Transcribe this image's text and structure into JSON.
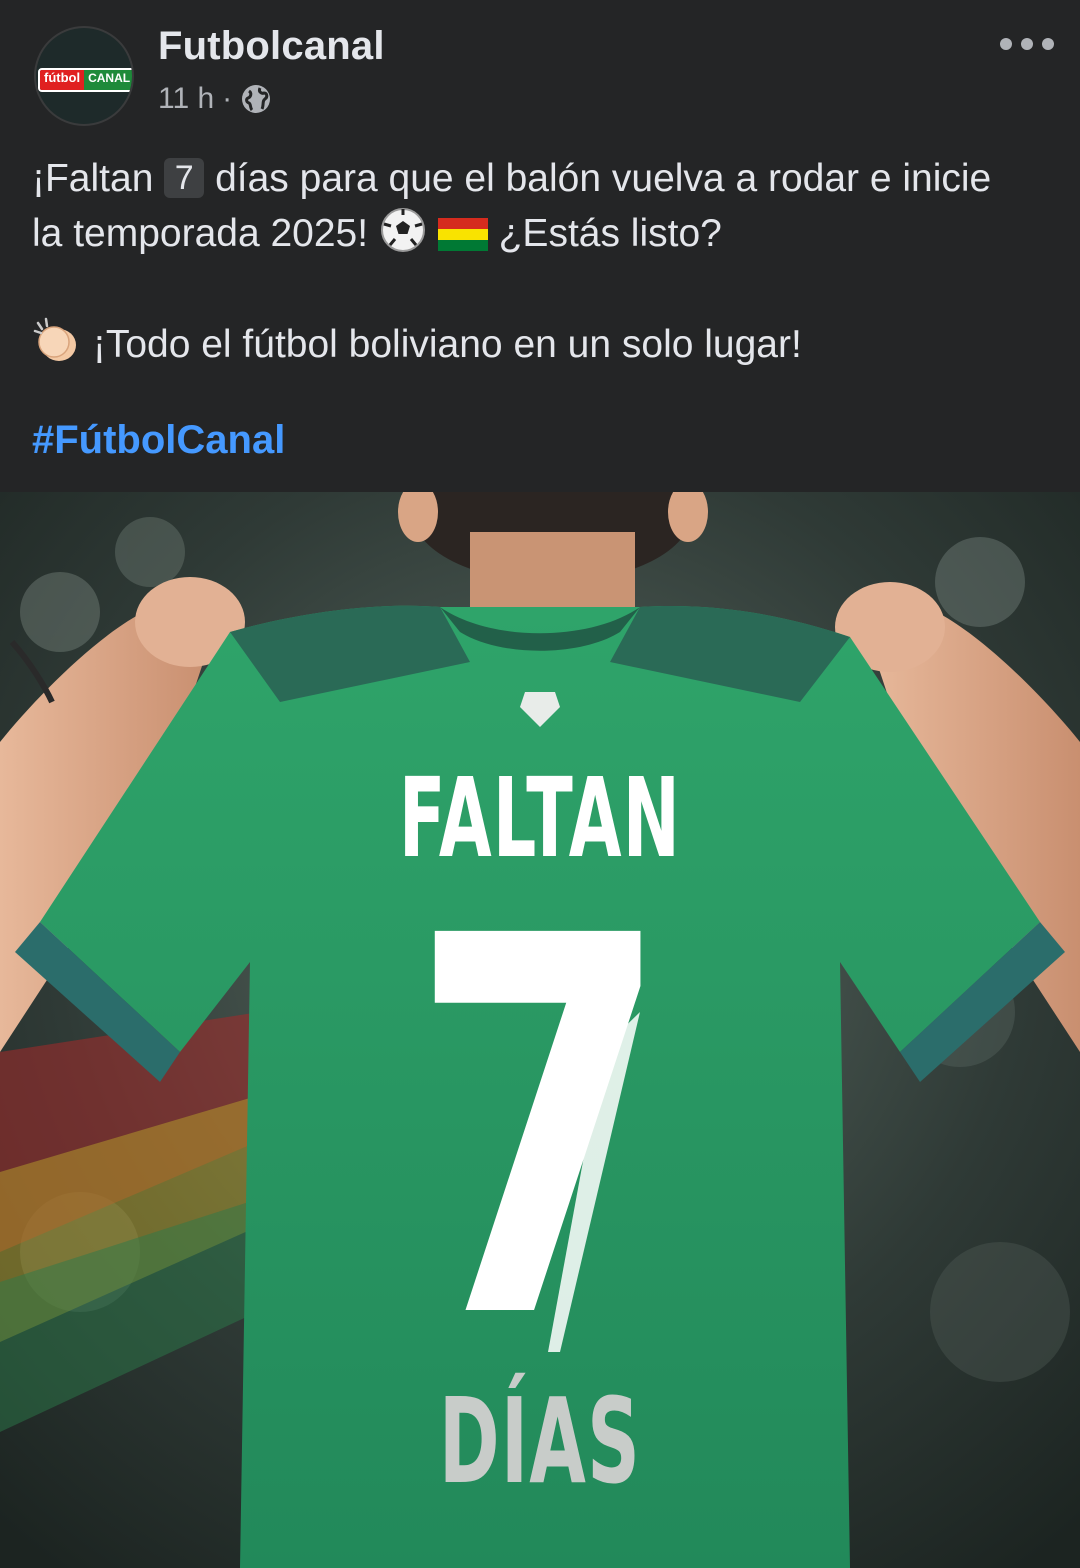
{
  "post": {
    "page_name": "Futbolcanal",
    "time": "11 h",
    "separator": "·",
    "avatar_logo": {
      "part1": "fútbol",
      "part2": "CANAL"
    },
    "text": {
      "line1_a": "¡Faltan",
      "line1_num": "7",
      "line1_b": "días para que el balón vuelva a rodar e inicie",
      "line2_a": "la temporada 2025!",
      "line2_b": "¿Estás listo?",
      "line3": "¡Todo el fútbol boliviano en un solo lugar!",
      "hashtag": "#FútbolCanal"
    },
    "image": {
      "top_text": "FALTAN",
      "number": "7",
      "bottom_text": "DÍAS"
    },
    "icons": [
      "globe-icon",
      "more-options-icon",
      "soccer-ball-emoji",
      "bolivia-flag-emoji",
      "clapping-hands-emoji"
    ],
    "colors": {
      "background": "#242526",
      "hashtag": "#4599ff",
      "jersey": "#2a9a63"
    }
  }
}
